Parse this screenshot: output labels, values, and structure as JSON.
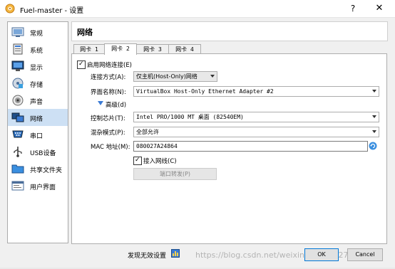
{
  "window": {
    "title": "Fuel-master - 设置",
    "help": "?",
    "close": "✕"
  },
  "sidebar": {
    "items": [
      {
        "label": "常规",
        "icon": "general-icon"
      },
      {
        "label": "系统",
        "icon": "system-icon"
      },
      {
        "label": "显示",
        "icon": "display-icon"
      },
      {
        "label": "存储",
        "icon": "storage-icon"
      },
      {
        "label": "声音",
        "icon": "audio-icon"
      },
      {
        "label": "网络",
        "icon": "network-icon"
      },
      {
        "label": "串口",
        "icon": "serial-port-icon"
      },
      {
        "label": "USB设备",
        "icon": "usb-icon"
      },
      {
        "label": "共享文件夹",
        "icon": "shared-folder-icon"
      },
      {
        "label": "用户界面",
        "icon": "user-interface-icon"
      }
    ],
    "selected": "网络"
  },
  "section": {
    "heading": "网络"
  },
  "tabs": [
    {
      "label": "网卡 1"
    },
    {
      "label": "网卡 2"
    },
    {
      "label": "网卡 3"
    },
    {
      "label": "网卡 4"
    }
  ],
  "active_tab": "网卡 2",
  "adapter": {
    "enable_label": "启用网络连接(E)",
    "enable_checked": true,
    "attached_label": "连接方式(A):",
    "attached_value": "仅主机(Host-Only)网络",
    "name_label": "界面名称(N):",
    "name_value": "VirtualBox Host-Only Ethernet Adapter #2",
    "advanced_label": "高级(d)",
    "chip_label": "控制芯片(T):",
    "chip_value": "Intel PRO/1000 MT 桌面 (82540EM)",
    "promisc_label": "混杂模式(P):",
    "promisc_value": "全部允许",
    "mac_label": "MAC 地址(M):",
    "mac_value": "080027A24864",
    "cable_label": "接入网线(C)",
    "cable_checked": true,
    "port_forward_label": "端口转发(P)"
  },
  "footer": {
    "invalid_settings": "发现无效设置",
    "ok": "OK",
    "cancel": "Cancel",
    "watermark": "https://blog.csdn.net/weixin_45013327"
  },
  "colors": {
    "selection": "#cde0f4",
    "accent": "#0078d7"
  }
}
